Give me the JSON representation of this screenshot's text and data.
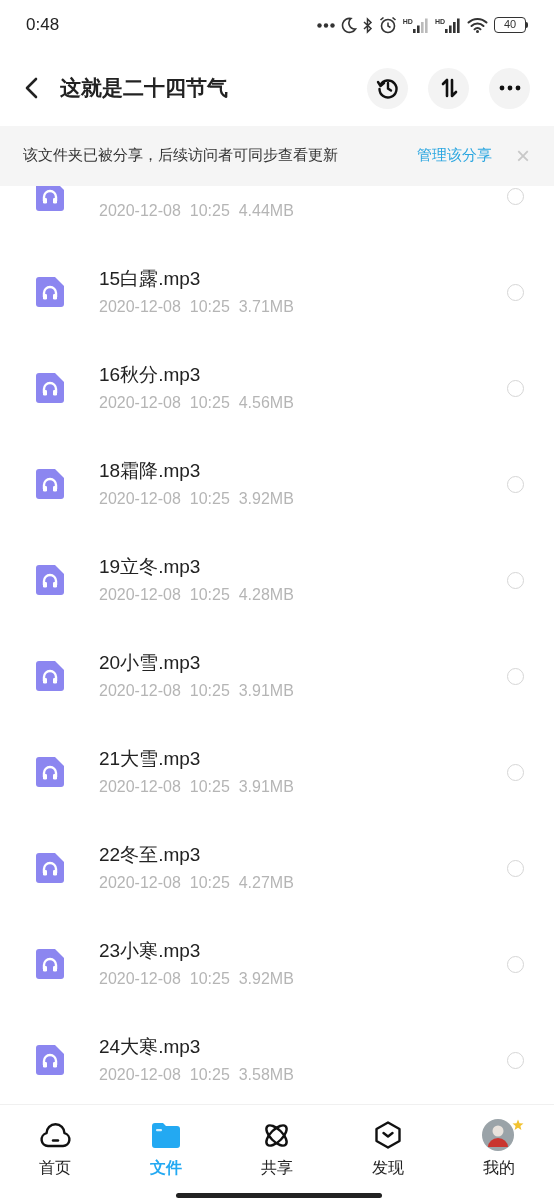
{
  "status_bar": {
    "time": "0:48",
    "signal_labels": [
      "HD",
      "HD"
    ],
    "battery": "40"
  },
  "header": {
    "title": "这就是二十四节气"
  },
  "banner": {
    "text": "该文件夹已被分享，后续访问者可同步查看更新",
    "link": "管理该分享",
    "close": "×"
  },
  "files": [
    {
      "date": "2020-12-08",
      "time": "10:25",
      "size": "4.44MB",
      "selected": false
    },
    {
      "name": "15白露.mp3",
      "date": "2020-12-08",
      "time": "10:25",
      "size": "3.71MB",
      "selected": false
    },
    {
      "name": "16秋分.mp3",
      "date": "2020-12-08",
      "time": "10:25",
      "size": "4.56MB",
      "selected": false
    },
    {
      "name": "18霜降.mp3",
      "date": "2020-12-08",
      "time": "10:25",
      "size": "3.92MB",
      "selected": false
    },
    {
      "name": "19立冬.mp3",
      "date": "2020-12-08",
      "time": "10:25",
      "size": "4.28MB",
      "selected": false
    },
    {
      "name": "20小雪.mp3",
      "date": "2020-12-08",
      "time": "10:25",
      "size": "3.91MB",
      "selected": false
    },
    {
      "name": "21大雪.mp3",
      "date": "2020-12-08",
      "time": "10:25",
      "size": "3.91MB",
      "selected": false
    },
    {
      "name": "22冬至.mp3",
      "date": "2020-12-08",
      "time": "10:25",
      "size": "4.27MB",
      "selected": false
    },
    {
      "name": "23小寒.mp3",
      "date": "2020-12-08",
      "time": "10:25",
      "size": "3.92MB",
      "selected": false
    },
    {
      "name": "24大寒.mp3",
      "date": "2020-12-08",
      "time": "10:25",
      "size": "3.58MB",
      "selected": false
    }
  ],
  "tabs": [
    {
      "kind": "home",
      "label": "首页",
      "selected": false
    },
    {
      "kind": "files",
      "label": "文件",
      "selected": true
    },
    {
      "kind": "share",
      "label": "共享",
      "selected": false
    },
    {
      "kind": "discover",
      "label": "发现",
      "selected": false
    },
    {
      "kind": "me",
      "label": "我的",
      "selected": false
    }
  ]
}
